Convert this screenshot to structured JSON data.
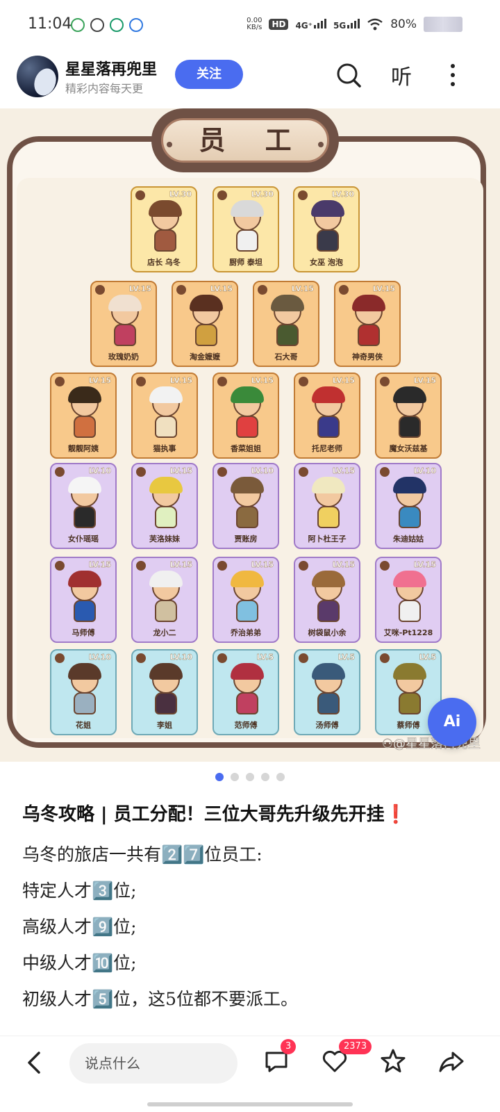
{
  "status": {
    "time": "11:04",
    "speed_top": "0.00",
    "speed_unit": "KB/s",
    "hd": "HD",
    "net1": "4G⁺",
    "net2": "5G",
    "battery": "80%"
  },
  "header": {
    "author": "星星落再兜里",
    "subtitle": "精彩内容每天更",
    "follow_label": "关注",
    "listen_label": "听"
  },
  "image": {
    "title": "员 工",
    "watermark": "⚇@星星落再兜里",
    "ai_label": "Ai",
    "cards": [
      {
        "name": "店长 乌冬",
        "lv": "LV.30"
      },
      {
        "name": "厨师 泰坦",
        "lv": "LV.30"
      },
      {
        "name": "女巫 泡泡",
        "lv": "LV.30"
      },
      {
        "name": "玫瑰奶奶",
        "lv": "LV.15"
      },
      {
        "name": "淘金嬷嬷",
        "lv": "LV.15"
      },
      {
        "name": "石大哥",
        "lv": "LV.15"
      },
      {
        "name": "神奇男侠",
        "lv": "LV.15"
      },
      {
        "name": "靓靓阿姨",
        "lv": "LV.15"
      },
      {
        "name": "猫执事",
        "lv": "LV.15"
      },
      {
        "name": "香菜姐姐",
        "lv": "LV.15"
      },
      {
        "name": "托尼老师",
        "lv": "LV.15"
      },
      {
        "name": "魔女沃兹基",
        "lv": "LV.15"
      },
      {
        "name": "女仆瑶瑶",
        "lv": "LV.10"
      },
      {
        "name": "芙洛妹妹",
        "lv": "LV.15"
      },
      {
        "name": "贾账房",
        "lv": "LV.10"
      },
      {
        "name": "阿卜杜王子",
        "lv": "LV.15"
      },
      {
        "name": "朱迪姑姑",
        "lv": "LV.10"
      },
      {
        "name": "马师傅",
        "lv": "LV.15"
      },
      {
        "name": "龙小二",
        "lv": "LV.15"
      },
      {
        "name": "乔治弟弟",
        "lv": "LV.15"
      },
      {
        "name": "树袋鼠小余",
        "lv": "LV.15"
      },
      {
        "name": "艾咪-Pt1228",
        "lv": "LV.15"
      },
      {
        "name": "花姐",
        "lv": "LV.10"
      },
      {
        "name": "李姐",
        "lv": "LV.10"
      },
      {
        "name": "范师傅",
        "lv": "LV.5"
      },
      {
        "name": "汤师傅",
        "lv": "LV.5"
      },
      {
        "name": "蔡师傅",
        "lv": "LV.5"
      }
    ]
  },
  "pager": {
    "total": 5,
    "active": 1
  },
  "post": {
    "title": "乌冬攻略 | 员工分配！三位大哥先升级先开挂❗",
    "lines": [
      "乌冬的旅店一共有2️⃣7️⃣位员工:",
      "特定人才3️⃣位;",
      "高级人才9️⃣位;",
      "中级人才🔟位;",
      "初级人才5️⃣位，这5位都不要派工。"
    ]
  },
  "bottombar": {
    "comment_placeholder": "说点什么",
    "comment_count": "3",
    "like_count": "2373"
  },
  "colors": {
    "accent": "#4a6cf0",
    "badge": "#ff3355"
  }
}
